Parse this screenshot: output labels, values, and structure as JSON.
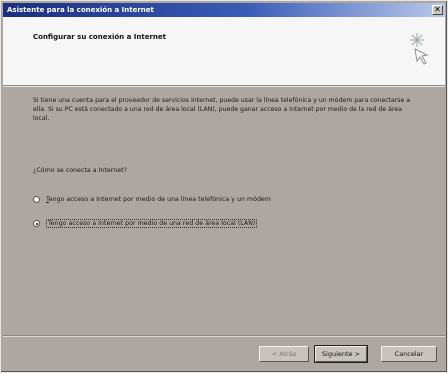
{
  "window": {
    "title": "Asistente para la conexión a Internet"
  },
  "header": {
    "title": "Configurar su conexión a Internet",
    "icon": "sparkle-icon"
  },
  "body": {
    "intro": "Si tiene una cuenta para el proveedor de servicios Internet, puede usar la línea telefónica y un módem para conectarse a ella. Si su PC está conectado a una red de área local (LAN), puede ganar acceso a Internet por medio de la red de área local.",
    "question": "¿Cómo se conecta a Internet?",
    "options": [
      {
        "label_first": "T",
        "label_rest": "engo acceso a Internet por medio de una línea telefónica y un módem",
        "selected": false
      },
      {
        "label": "Tengo acceso a Internet por medio de una red de área local (LAN)",
        "selected": true
      }
    ]
  },
  "buttons": {
    "back": "< Atrás",
    "next": "Siguiente >",
    "cancel": "Cancelar"
  }
}
